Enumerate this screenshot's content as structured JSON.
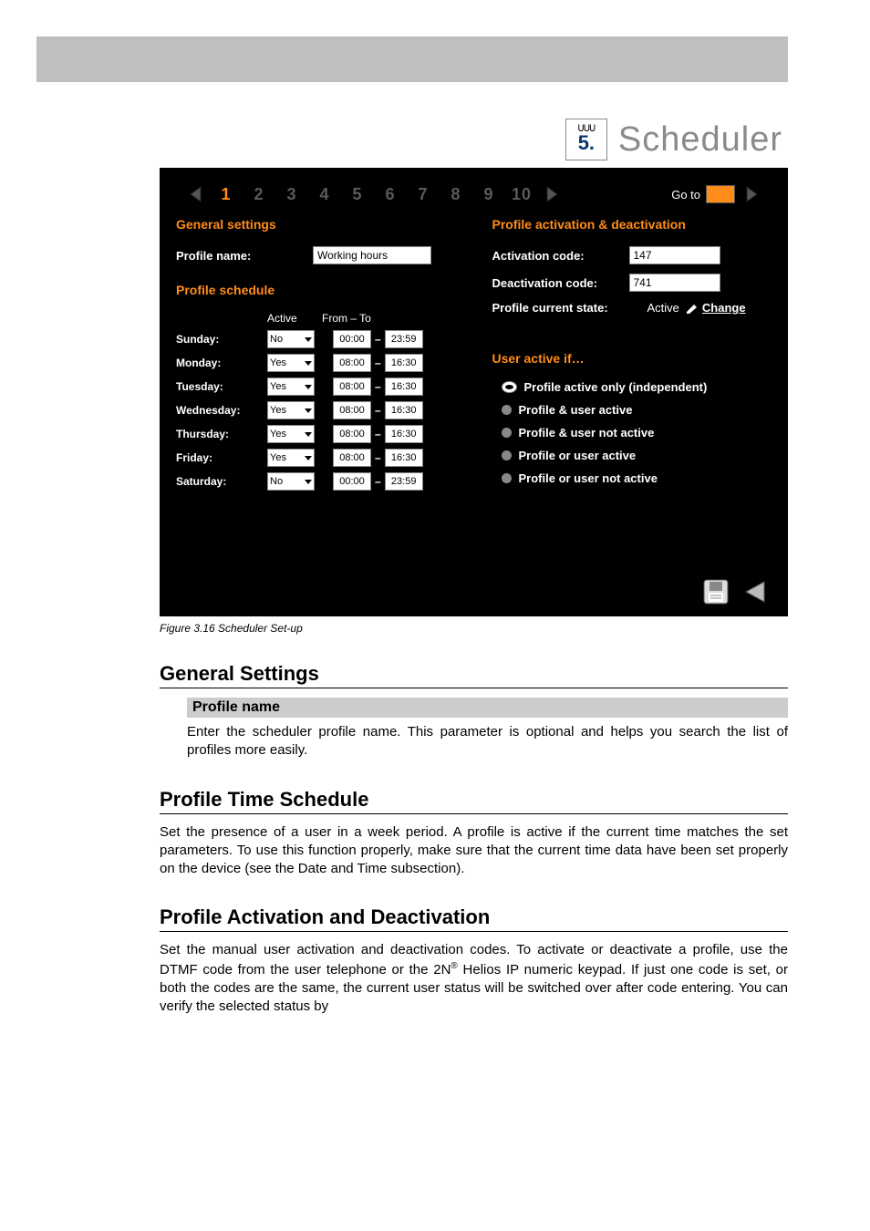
{
  "app": {
    "title": "Scheduler",
    "icon_rings": "ᑌᑌᑌ",
    "icon_number": "5.",
    "pager": {
      "items": [
        "1",
        "2",
        "3",
        "4",
        "5",
        "6",
        "7",
        "8",
        "9",
        "10"
      ],
      "active_index": 0,
      "goto_label": "Go to"
    }
  },
  "general": {
    "title": "General settings",
    "profile_name_label": "Profile name:",
    "profile_name_value": "Working hours"
  },
  "schedule": {
    "title": "Profile schedule",
    "head_active": "Active",
    "head_fromto": "From – To",
    "rows": [
      {
        "day": "Sunday:",
        "active": "No",
        "from": "00:00",
        "to": "23:59"
      },
      {
        "day": "Monday:",
        "active": "Yes",
        "from": "08:00",
        "to": "16:30"
      },
      {
        "day": "Tuesday:",
        "active": "Yes",
        "from": "08:00",
        "to": "16:30"
      },
      {
        "day": "Wednesday:",
        "active": "Yes",
        "from": "08:00",
        "to": "16:30"
      },
      {
        "day": "Thursday:",
        "active": "Yes",
        "from": "08:00",
        "to": "16:30"
      },
      {
        "day": "Friday:",
        "active": "Yes",
        "from": "08:00",
        "to": "16:30"
      },
      {
        "day": "Saturday:",
        "active": "No",
        "from": "00:00",
        "to": "23:59"
      }
    ]
  },
  "activation": {
    "title": "Profile activation & deactivation",
    "act_code_label": "Activation code:",
    "act_code_value": "147",
    "deact_code_label": "Deactivation code:",
    "deact_code_value": "741",
    "state_label": "Profile current state:",
    "state_value": "Active",
    "change_label": "Change"
  },
  "useractive": {
    "title": "User active if…",
    "options": [
      "Profile active only (independent)",
      "Profile & user active",
      "Profile & user not active",
      "Profile or user active",
      "Profile or user not active"
    ],
    "selected_index": 0
  },
  "doc": {
    "caption": "Figure 3.16   Scheduler Set-up",
    "h2a": "General Settings",
    "h3a": "Profile name",
    "p1": "Enter the scheduler profile name. This parameter is optional and helps you search the list of profiles more easily.",
    "h2b": "Profile Time Schedule",
    "p2": "Set the presence of a user in a week period. A profile is active if the current time matches the set parameters. To use this function properly, make sure that the current time data have been set properly on the device (see the Date and Time subsection).",
    "h2c": "Profile Activation and Deactivation",
    "p3a": "Set the manual user activation and deactivation codes. To activate or deactivate a profile, use the DTMF code from the user telephone or the 2N",
    "p3b": " Helios IP numeric keypad. If just one code is set, or both the codes are the same, the current user status will be switched over after code entering. You can verify the selected status by"
  }
}
